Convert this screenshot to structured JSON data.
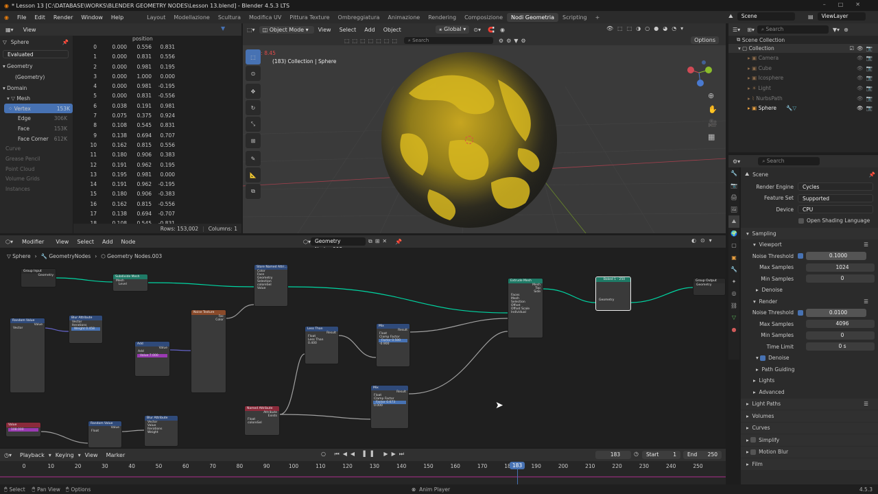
{
  "titlebar": {
    "title": "* Lesson 13 [C:\\DATABASE\\WORKS\\BLENDER GEOMETRY NODES\\Lesson 13.blend] - Blender 4.5.3 LTS"
  },
  "menubar": {
    "items": [
      "File",
      "Edit",
      "Render",
      "Window",
      "Help"
    ],
    "workspaces": [
      "Layout",
      "Modellazione",
      "Scultura",
      "Modifica UV",
      "Pittura Texture",
      "Ombreggiatura",
      "Animazione",
      "Rendering",
      "Composizione",
      "Nodi Geometria",
      "Scripting"
    ],
    "active_ws": "Nodi Geometria",
    "scene": "Scene",
    "view_layer": "ViewLayer"
  },
  "spreadsheet": {
    "view": "View",
    "object": "Sphere",
    "mode": "Evaluated",
    "geometry": "Geometry",
    "geometry_item": "(Geometry)",
    "domain": "Domain",
    "mesh": "Mesh",
    "domains": [
      {
        "label": "Vertex",
        "count": "153K"
      },
      {
        "label": "Edge",
        "count": "306K"
      },
      {
        "label": "Face",
        "count": "153K"
      },
      {
        "label": "Face Corner",
        "count": "612K"
      }
    ],
    "disabled": [
      "Curve",
      "Grease Pencil",
      "Point Cloud",
      "Volume Grids",
      "Instances"
    ],
    "column": "position",
    "rows": [
      [
        "0",
        "0.000",
        "0.556",
        "0.831"
      ],
      [
        "1",
        "0.000",
        "0.831",
        "0.556"
      ],
      [
        "2",
        "0.000",
        "0.981",
        "0.195"
      ],
      [
        "3",
        "0.000",
        "1.000",
        "0.000"
      ],
      [
        "4",
        "0.000",
        "0.981",
        "-0.195"
      ],
      [
        "5",
        "0.000",
        "0.831",
        "-0.556"
      ],
      [
        "6",
        "0.038",
        "0.191",
        "0.981"
      ],
      [
        "7",
        "0.075",
        "0.375",
        "0.924"
      ],
      [
        "8",
        "0.108",
        "0.545",
        "0.831"
      ],
      [
        "9",
        "0.138",
        "0.694",
        "0.707"
      ],
      [
        "10",
        "0.162",
        "0.815",
        "0.556"
      ],
      [
        "11",
        "0.180",
        "0.906",
        "0.383"
      ],
      [
        "12",
        "0.191",
        "0.962",
        "0.195"
      ],
      [
        "13",
        "0.195",
        "0.981",
        "0.000"
      ],
      [
        "14",
        "0.191",
        "0.962",
        "-0.195"
      ],
      [
        "15",
        "0.180",
        "0.906",
        "-0.383"
      ],
      [
        "16",
        "0.162",
        "0.815",
        "-0.556"
      ],
      [
        "17",
        "0.138",
        "0.694",
        "-0.707"
      ],
      [
        "18",
        "0.108",
        "0.545",
        "-0.831"
      ]
    ],
    "footer_rows": "Rows: 153,002",
    "footer_cols": "Columns: 1"
  },
  "viewport": {
    "mode": "Object Mode",
    "menus": [
      "View",
      "Select",
      "Add",
      "Object"
    ],
    "orientation": "Global",
    "options": "Options",
    "fps": "fps: 8.45",
    "info": "(183) Collection | Sphere",
    "search": "Search"
  },
  "outliner": {
    "search": "Search",
    "scene_collection": "Scene Collection",
    "collection": "Collection",
    "items": [
      "Camera",
      "Cube",
      "Icosphere",
      "Light",
      "NurbsPath",
      "Sphere"
    ]
  },
  "properties": {
    "search": "Search",
    "scene": "Scene",
    "render_engine_label": "Render Engine",
    "render_engine": "Cycles",
    "feature_set_label": "Feature Set",
    "feature_set": "Supported",
    "device_label": "Device",
    "device": "CPU",
    "osl": "Open Shading Language",
    "sampling": "Sampling",
    "viewport": "Viewport",
    "noise_threshold_label": "Noise Threshold",
    "vp_noise": "0.1000",
    "max_samples_label": "Max Samples",
    "vp_max": "1024",
    "min_samples_label": "Min Samples",
    "vp_min": "0",
    "denoise": "Denoise",
    "render": "Render",
    "r_noise": "0.0100",
    "r_max": "4096",
    "r_min": "0",
    "time_limit_label": "Time Limit",
    "r_time": "0 s",
    "path_guiding": "Path Guiding",
    "lights": "Lights",
    "advanced": "Advanced",
    "light_paths": "Light Paths",
    "volumes": "Volumes",
    "curves": "Curves",
    "simplify": "Simplify",
    "motion_blur": "Motion Blur",
    "film": "Film"
  },
  "node_editor": {
    "type": "Modifier",
    "menus": [
      "View",
      "Select",
      "Add",
      "Node"
    ],
    "tree": "Geometry Nodes.003",
    "breadcrumb": [
      "Sphere",
      "GeometryNodes",
      "Geometry Nodes.003"
    ],
    "nodes": {
      "group_input": "Group Input",
      "geometry": "Geometry",
      "subdivide": "Subdivide Mesh",
      "mesh": "Mesh",
      "level": "Level",
      "store": "Store Named Attri...",
      "color": "Color",
      "face": "Face",
      "selection": "Selection",
      "name": "coloreSel",
      "value": "Value",
      "noise": "Noise Texture",
      "fac": "Fac",
      "extrude": "Extrude Mesh",
      "top": "Top",
      "side": "Side",
      "faces": "Faces",
      "offset": "Offset",
      "offset_scale": "Offset Scale",
      "individual": "Individual",
      "bake": "Baked 1 - 250",
      "group_output": "Group Output",
      "random": "Random Value",
      "blur": "Blur Attribute",
      "add": "Add",
      "less": "Less Than",
      "mix": "Mix",
      "result": "Result",
      "named": "Named Attribute",
      "attribute": "Attribute",
      "exists": "Exists",
      "float": "Float",
      "vector": "Vector",
      "factor": "Factor",
      "clamp": "Clamp Factor",
      "iterations": "Iterations",
      "weight": "Weight",
      "value_num": "7.000",
      "w1": "0.458",
      "f1": "0.500",
      "f2": "0.673",
      "b1": "-0.900",
      "b2": "0.000",
      "thr": "0.400",
      "v108": "108.000"
    }
  },
  "timeline": {
    "menus": [
      "Playback",
      "Keying",
      "View",
      "Marker"
    ],
    "frame": "183",
    "start_label": "Start",
    "start": "1",
    "end_label": "End",
    "end": "250",
    "ticks": [
      "0",
      "10",
      "20",
      "30",
      "40",
      "50",
      "60",
      "70",
      "80",
      "90",
      "100",
      "110",
      "120",
      "130",
      "140",
      "150",
      "160",
      "170",
      "180",
      "190",
      "200",
      "210",
      "220",
      "230",
      "240",
      "250"
    ]
  },
  "statusbar": {
    "select": "Select",
    "pan": "Pan View",
    "options": "Options",
    "center": "Anim Player",
    "version": "4.5.3"
  },
  "colors": {
    "accent": "#4772b3",
    "active_tab": "#3d3d3d",
    "yellow": "#d4b422"
  }
}
